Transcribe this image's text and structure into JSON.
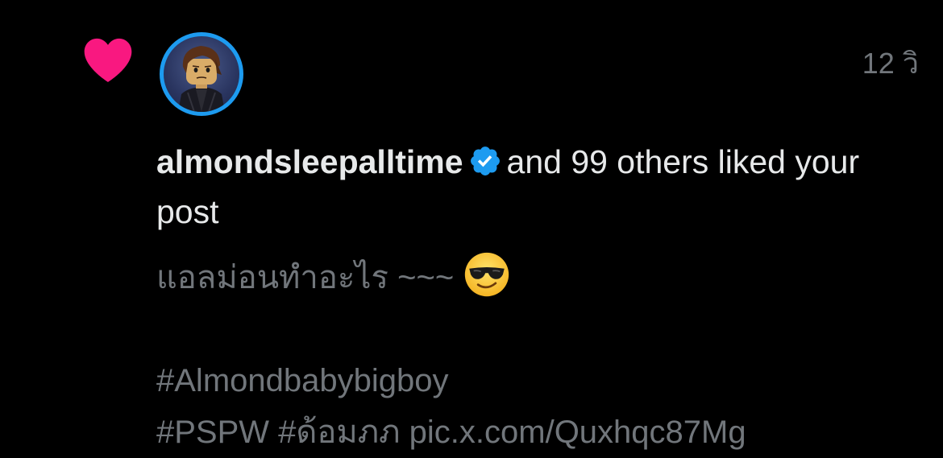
{
  "notification": {
    "type_icon": "heart-icon",
    "avatar_icon": "lego-avatar",
    "timestamp": "12 วิ",
    "username": "almondsleepalltime",
    "verified_icon": "verified-badge-icon",
    "action_text": "and 99 others liked your post",
    "post": {
      "line1": "แอลม่อนทำอะไร ~~~",
      "emoji": "smiling-face-with-sunglasses",
      "hashtag1": "#Almondbabybigboy",
      "hashtag2": "#PSPW",
      "hashtag3": "#ด้อมภภ",
      "link": "pic.x.com/Quxhqc87Mg"
    }
  },
  "colors": {
    "background": "#000000",
    "heart": "#f91880",
    "verified": "#1d9bf0",
    "avatar_ring": "#1d9bf0",
    "primary_text": "#e7e9ea",
    "secondary_text": "#71767b"
  }
}
